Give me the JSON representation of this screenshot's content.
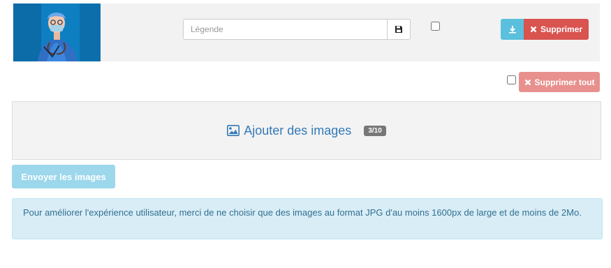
{
  "image_row": {
    "thumbnail_icon": "image-thumbnail",
    "caption_placeholder": "Légende",
    "caption_value": "",
    "save_icon": "floppy-disk-icon",
    "selected": false,
    "download_icon": "download-icon",
    "delete_label": "Supprimer",
    "delete_icon": "times-icon"
  },
  "bulk": {
    "select_all": false,
    "delete_all_label": "Supprimer tout",
    "delete_all_icon": "times-icon"
  },
  "dropzone": {
    "icon": "picture-icon",
    "label": "Ajouter des images",
    "count_badge": "3/10"
  },
  "actions": {
    "send_label": "Envoyer les images"
  },
  "info": {
    "message": "Pour améliorer l'expérience utilisateur, merci de ne choisir que des images au format JPG d'au moins 1600px de large et de moins de 2Mo."
  },
  "colors": {
    "primary": "#337ab7",
    "info": "#5bc0de",
    "danger": "#d9534f",
    "danger_disabled": "#e8908d",
    "send_disabled": "#9cd7ec",
    "alert_bg": "#d9edf7",
    "alert_text": "#31708f"
  }
}
